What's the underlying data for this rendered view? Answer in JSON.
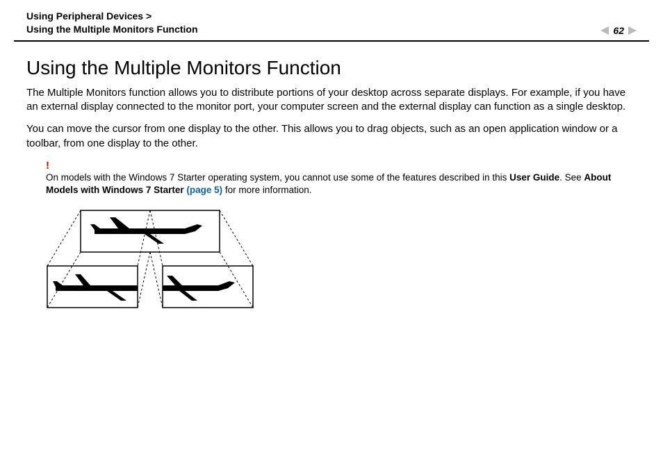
{
  "header": {
    "breadcrumb_line1": "Using Peripheral Devices >",
    "breadcrumb_line2": "Using the Multiple Monitors Function",
    "page_number": "62"
  },
  "title": "Using the Multiple Monitors Function",
  "paragraphs": [
    "The Multiple Monitors function allows you to distribute portions of your desktop across separate displays. For example, if you have an external display connected to the monitor port, your computer screen and the external display can function as a single desktop.",
    "You can move the cursor from one display to the other. This allows you to drag objects, such as an open application window or a toolbar, from one display to the other."
  ],
  "note": {
    "bang": "!",
    "part1": "On models with the Windows 7 Starter operating system, you cannot use some of the features described in this ",
    "bold1": "User Guide",
    "part2": ". See ",
    "bold2": "About Models with Windows 7 Starter ",
    "link_text": "(page 5)",
    "part3": " for more information."
  },
  "icons": {
    "prev": "previous-page",
    "next": "next-page"
  }
}
